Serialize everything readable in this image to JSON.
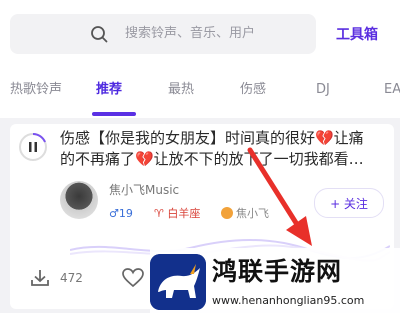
{
  "search": {
    "placeholder": "搜索铃声、音乐、用户"
  },
  "header": {
    "toolbox_label": "工具箱"
  },
  "tabs": [
    {
      "label": "热歌铃声"
    },
    {
      "label": "推荐",
      "active": true
    },
    {
      "label": "最热"
    },
    {
      "label": "伤感"
    },
    {
      "label": "DJ"
    },
    {
      "label": "EA"
    }
  ],
  "card": {
    "title_line1": "伤感【你是我的女朋友】时间真的很好💔让痛",
    "title_line2": "的不再痛了💔让放不下的放下了一切我都看…",
    "username": "焦小飞Music",
    "fans": "♂19",
    "zodiac": "♈ 白羊座",
    "nickname_badge": "焦小飞",
    "follow_label": "+ 关注",
    "download_count": "472"
  },
  "watermark": {
    "text": "鸿联手游网",
    "url": "www.henanhonglian95.com"
  },
  "colors": {
    "accent": "#5a2ee0",
    "arrow": "#e8302a"
  }
}
